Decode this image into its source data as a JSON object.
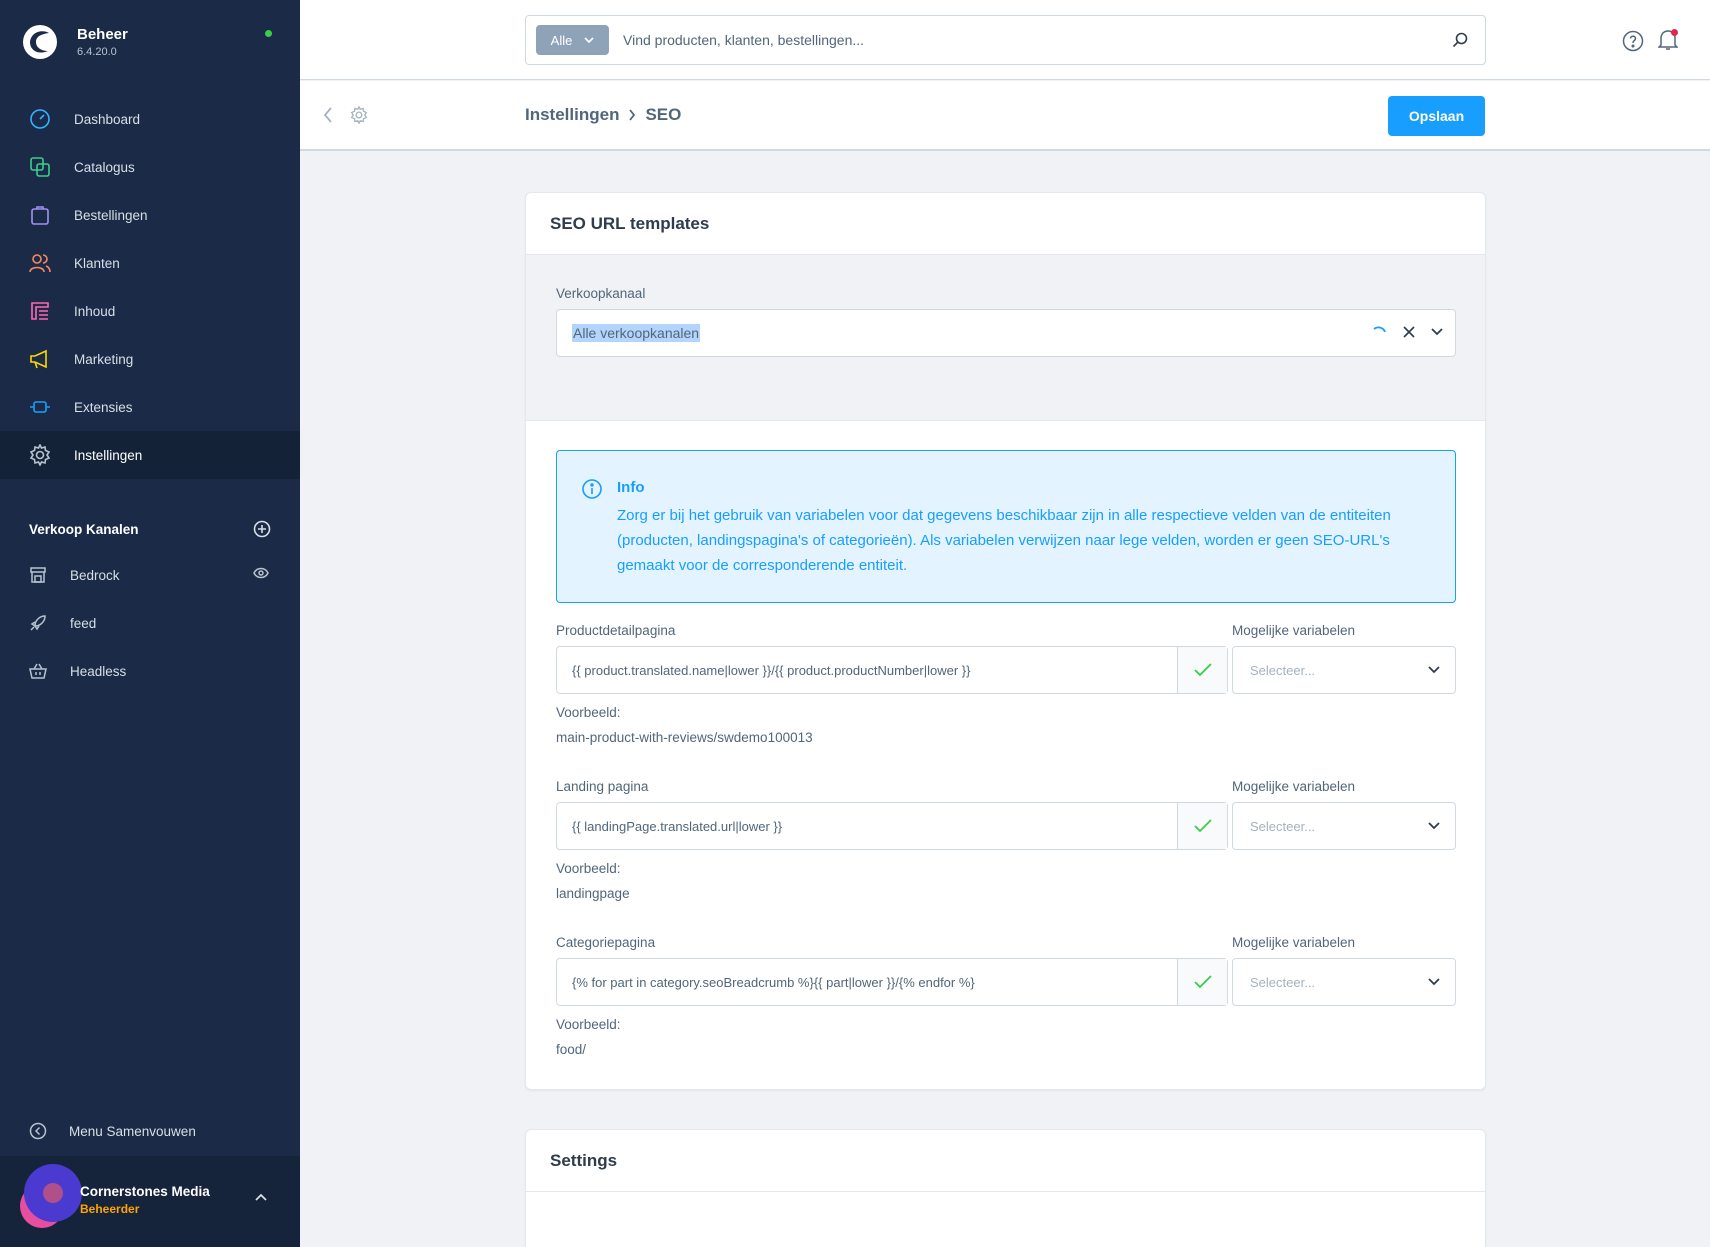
{
  "app": {
    "name": "Beheer",
    "version": "6.4.20.0",
    "status_color": "#37d046",
    "accent": "#189eff"
  },
  "sidebar": {
    "items": [
      {
        "label": "Dashboard",
        "icon": "dashboard-icon"
      },
      {
        "label": "Catalogus",
        "icon": "catalog-icon"
      },
      {
        "label": "Bestellingen",
        "icon": "orders-icon"
      },
      {
        "label": "Klanten",
        "icon": "customers-icon"
      },
      {
        "label": "Inhoud",
        "icon": "content-icon"
      },
      {
        "label": "Marketing",
        "icon": "marketing-icon"
      },
      {
        "label": "Extensies",
        "icon": "extensions-icon"
      },
      {
        "label": "Instellingen",
        "icon": "settings-icon",
        "active": true
      }
    ],
    "channels_heading": "Verkoop Kanalen",
    "channels": [
      {
        "label": "Bedrock",
        "icon": "storefront-icon"
      },
      {
        "label": "feed",
        "icon": "rocket-icon"
      },
      {
        "label": "Headless",
        "icon": "basket-icon"
      }
    ],
    "collapse_label": "Menu Samenvouwen",
    "user": {
      "name": "Cornerstones Media",
      "role": "Beheerder"
    }
  },
  "search": {
    "type_label": "Alle",
    "placeholder": "Vind producten, klanten, bestellingen..."
  },
  "smartbar": {
    "breadcrumb": [
      "Instellingen",
      "SEO"
    ],
    "save_label": "Opslaan"
  },
  "seo_card": {
    "title": "SEO URL templates",
    "channel_label": "Verkoopkanaal",
    "channel_value": "Alle verkoopkanalen",
    "info": {
      "title": "Info",
      "text": "Zorg er bij het gebruik van variabelen voor dat gegevens beschikbaar zijn in alle respectieve velden van de entiteiten (producten, landingspagina's of categorieën). Als variabelen verwijzen naar lege velden, worden er geen SEO-URL's gemaakt voor de corresponderende entiteit."
    },
    "templates": [
      {
        "label": "Productdetailpagina",
        "value": "{{ product.translated.name|lower }}/{{ product.productNumber|lower }}",
        "variables_label": "Mogelijke variabelen",
        "variables_placeholder": "Selecteer...",
        "example_label": "Voorbeeld:",
        "example_value": "main-product-with-reviews/swdemo100013"
      },
      {
        "label": "Landing pagina",
        "value": "{{ landingPage.translated.url|lower }}",
        "variables_label": "Mogelijke variabelen",
        "variables_placeholder": "Selecteer...",
        "example_label": "Voorbeeld:",
        "example_value": "landingpage"
      },
      {
        "label": "Categoriepagina",
        "value": "{% for part in category.seoBreadcrumb %}{{ part|lower }}/{% endfor %}",
        "variables_label": "Mogelijke variabelen",
        "variables_placeholder": "Selecteer...",
        "example_label": "Voorbeeld:",
        "example_value": "food/"
      }
    ]
  },
  "settings_card": {
    "title": "Settings"
  }
}
